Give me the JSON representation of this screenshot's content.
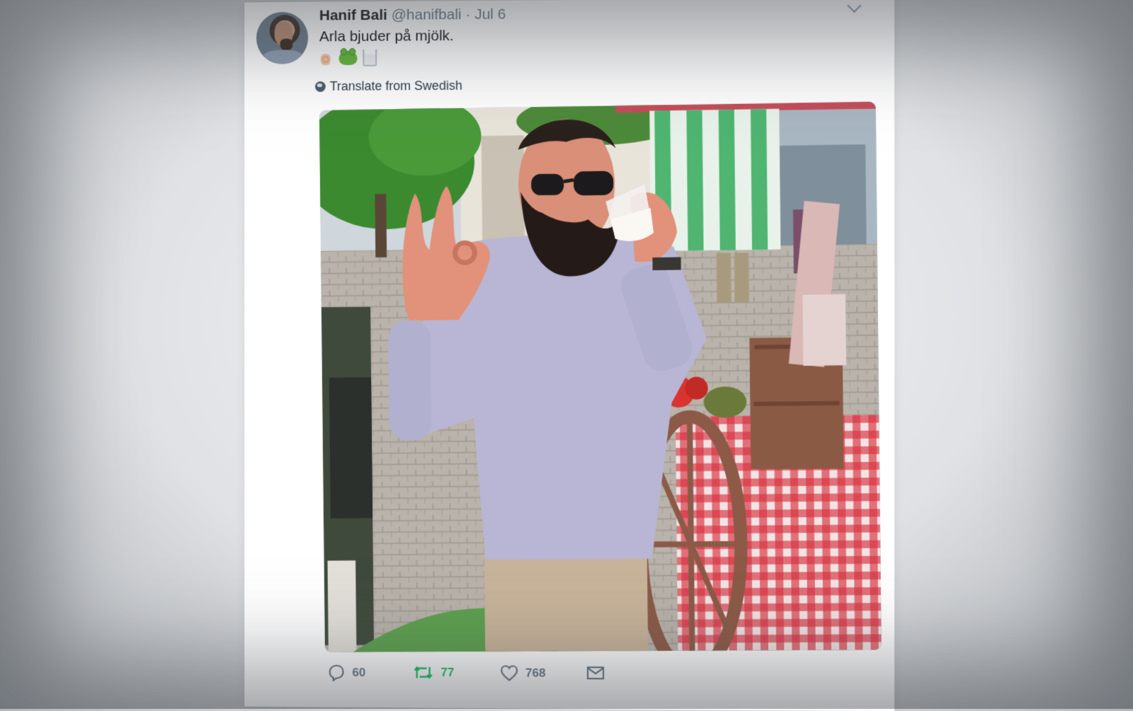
{
  "tweet": {
    "display_name": "Hanif Bali",
    "handle": "@hanifbali",
    "separator": "·",
    "date": "Jul 6",
    "text": "Arla bjuder på mjölk.",
    "emojis": [
      "ok-hand",
      "frog",
      "milk-glass"
    ],
    "translate_label": "Translate from Swedish",
    "actions": {
      "replies": "60",
      "retweets": "77",
      "likes": "768"
    }
  },
  "colors": {
    "retweet_active": "#17bf63",
    "secondary_text": "#657786",
    "primary_text": "#14171a"
  },
  "icons": [
    "caret-down-icon",
    "globe-icon",
    "reply-icon",
    "retweet-icon",
    "heart-icon",
    "mail-icon"
  ]
}
